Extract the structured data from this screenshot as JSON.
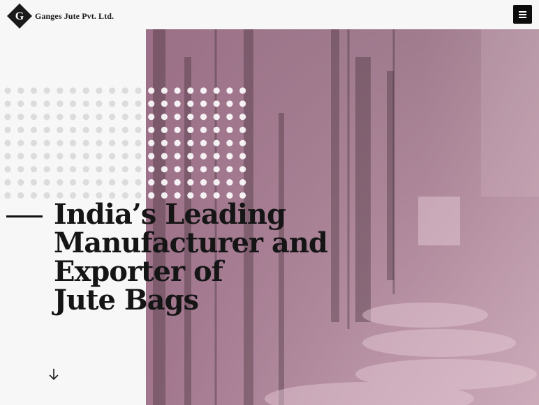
{
  "header": {
    "brand_name": "Ganges Jute Pvt. Ltd.",
    "logo_letter": "G",
    "menu_icon": "hamburger-menu-icon"
  },
  "hero": {
    "headline_lines": [
      "India’s Leading",
      "Manufacturer and",
      "Exporter of",
      "Jute Bags"
    ],
    "image_description_icon": "factory-machinery-image",
    "scroll_icon": "arrow-down-icon"
  },
  "colors": {
    "background": "#f7f7f7",
    "hero_tint": "#a47a90",
    "text": "#151515",
    "menu_button": "#0c0c0c"
  }
}
